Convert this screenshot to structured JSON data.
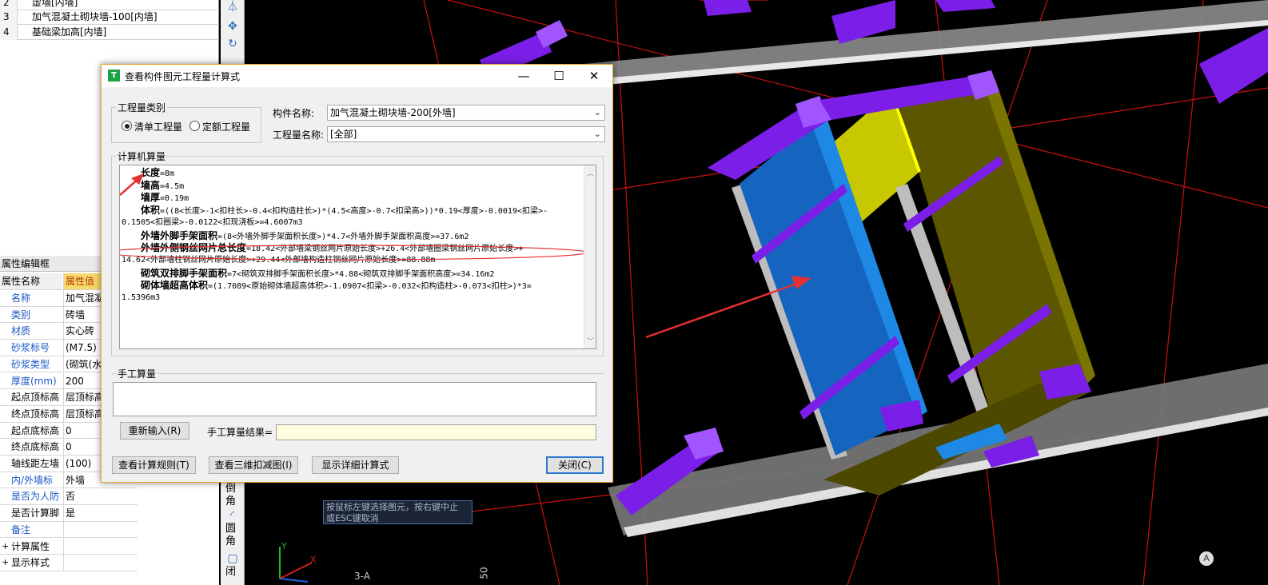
{
  "list": {
    "rows": [
      {
        "num": "2",
        "label": "虚墙[内墙]"
      },
      {
        "num": "3",
        "label": "加气混凝土砌块墙-100[内墙]"
      },
      {
        "num": "4",
        "label": "基础梁加高[内墙]"
      }
    ]
  },
  "toolbar": {
    "chamfer": "倒角",
    "fillet": "圆角",
    "closed": "闭"
  },
  "properties": {
    "title": "属性编辑框",
    "header_name": "属性名称",
    "header_value": "属性值",
    "rows": [
      {
        "name": "名称",
        "value": "加气混凝",
        "blue": true
      },
      {
        "name": "类别",
        "value": "砖墙",
        "blue": true
      },
      {
        "name": "材质",
        "value": "实心砖",
        "blue": true
      },
      {
        "name": "砂浆标号",
        "value": "(M7.5)",
        "blue": true
      },
      {
        "name": "砂浆类型",
        "value": "(砌筑(水",
        "blue": true
      },
      {
        "name": "厚度(mm)",
        "value": "200",
        "blue": true
      },
      {
        "name": "起点顶标高",
        "value": "层顶标高",
        "blue": false
      },
      {
        "name": "终点顶标高",
        "value": "层顶标高",
        "blue": false
      },
      {
        "name": "起点底标高",
        "value": "0",
        "blue": false
      },
      {
        "name": "终点底标高",
        "value": "0",
        "blue": false
      },
      {
        "name": "轴线距左墙",
        "value": "(100)",
        "blue": false
      },
      {
        "name": "内/外墙标",
        "value": "外墙",
        "blue": true
      },
      {
        "name": "是否为人防",
        "value": "否",
        "blue": true
      },
      {
        "name": "是否计算脚",
        "value": "是",
        "blue": false
      },
      {
        "name": "备注",
        "value": "",
        "blue": true
      },
      {
        "name": "计算属性",
        "value": "",
        "blue": false,
        "expand": "+"
      },
      {
        "name": "显示样式",
        "value": "",
        "blue": false,
        "expand": "+"
      }
    ]
  },
  "dialog": {
    "title": "查看构件图元工程量计算式",
    "qty_category_label": "工程量类别",
    "radio_bill": "清单工程量",
    "radio_quota": "定额工程量",
    "component_name_label": "构件名称:",
    "component_name_value": "加气混凝土砌块墙-200[外墙]",
    "qty_name_label": "工程量名称:",
    "qty_name_value": "[全部]",
    "calc_label": "计算机算量",
    "calc_lines": [
      {
        "key": "长度",
        "expr": "=8m"
      },
      {
        "key": "墙高",
        "expr": "=4.5m"
      },
      {
        "key": "墙厚",
        "expr": "=0.19m"
      },
      {
        "key": "体积",
        "expr": "=((8<长度>-1<扣柱长>-0.4<扣构造柱长>)*(4.5<高度>-0.7<扣梁高>))*0.19<厚度>-0.0019<扣梁>-"
      },
      {
        "key": "",
        "expr": "0.1505<扣圈梁>-0.0122<扣现浇板>=4.6007m3"
      },
      {
        "key": "外墙外脚手架面积",
        "expr": "=(8<外墙外脚手架面积长度>)*4.7<外墙外脚手架面积高度>=37.6m2"
      },
      {
        "key": "外墙外侧钢丝网片总长度",
        "expr": "=18.42<外部墙梁钢丝网片原始长度>+26.4<外部墙圈梁钢丝网片原始长度>+"
      },
      {
        "key": "",
        "expr": "14.62<外部墙柱钢丝网片原始长度>+29.44<外部墙构造柱钢丝网片原始长度>=88.88m"
      },
      {
        "key": "砌筑双排脚手架面积",
        "expr": "=7<砌筑双排脚手架面积长度>*4.88<砌筑双排脚手架面积高度>=34.16m2"
      },
      {
        "key": "砌体墙超高体积",
        "expr": "=(1.7089<原始砌体墙超高体积>-1.0907<扣梁>-0.032<扣构造柱>-0.073<扣柱>)*3="
      },
      {
        "key": "",
        "expr": "1.5396m3"
      }
    ],
    "manual_label": "手工算量",
    "reenter_btn": "重新输入(R)",
    "manual_result_label": "手工算量结果=",
    "view_rules_btn": "查看计算规则(T)",
    "view_3d_btn": "查看三维扣减图(I)",
    "show_detail_btn": "显示详细计算式",
    "close_btn": "关闭(C)"
  },
  "tooltip": {
    "line1": "按鼠标左键选择图元，按右键中止",
    "line2": "或ESC键取消"
  },
  "viewport": {
    "axis_label": "3-A",
    "dim_label": "50",
    "axis_y": "Y",
    "axis_x": "X"
  },
  "colors": {
    "wall_blue": "#1565c0",
    "wall_yellow": "#c8c800",
    "column_purple": "#7b1fe8",
    "wall_olive": "#5c5600",
    "grid_red": "#d01010",
    "annotation_red": "#e53030"
  }
}
